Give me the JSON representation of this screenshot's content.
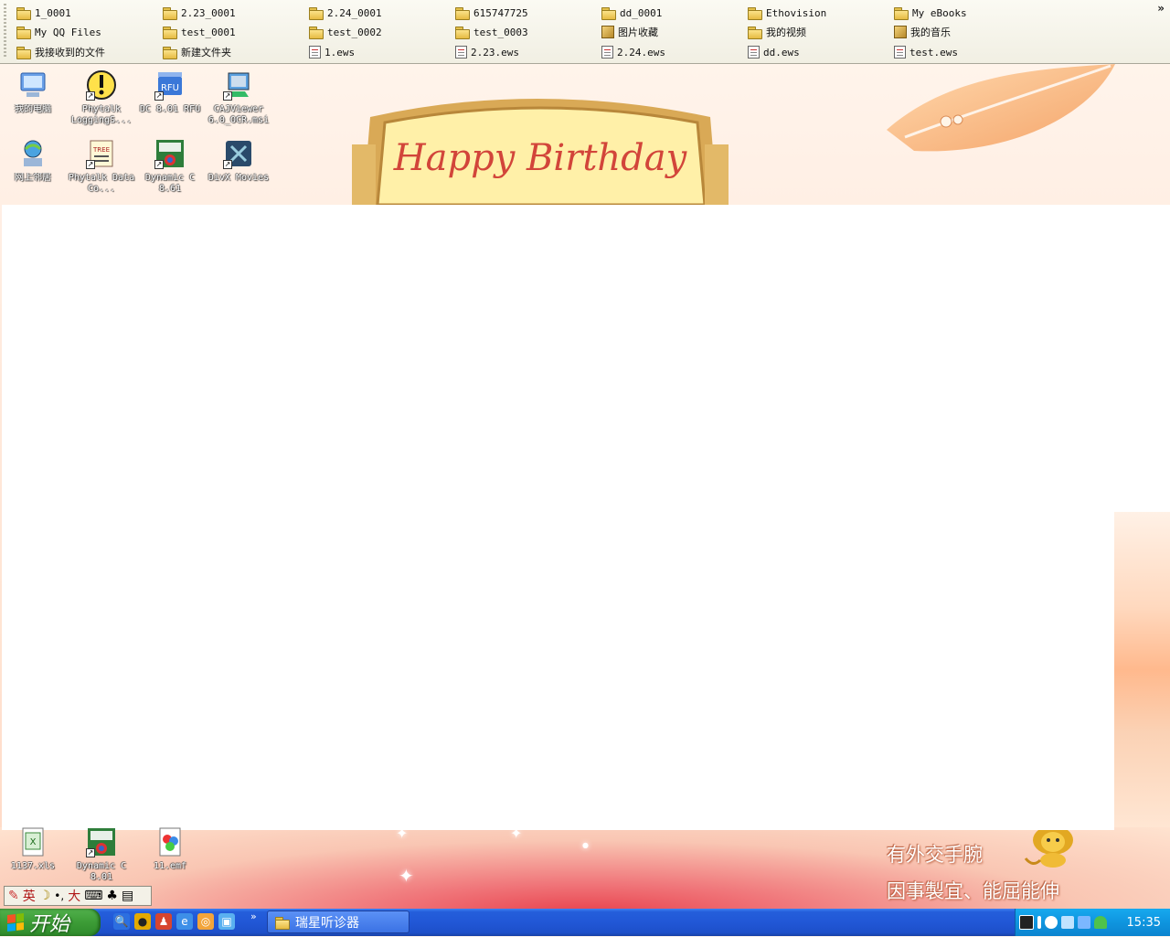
{
  "toolbar": {
    "overflow": "»",
    "items": [
      {
        "label": "1_0001",
        "icon": "folder"
      },
      {
        "label": "2.23_0001",
        "icon": "folder"
      },
      {
        "label": "2.24_0001",
        "icon": "folder"
      },
      {
        "label": "615747725",
        "icon": "folder"
      },
      {
        "label": "dd_0001",
        "icon": "folder"
      },
      {
        "label": "Ethovision",
        "icon": "folder"
      },
      {
        "label": "My eBooks",
        "icon": "folder"
      },
      {
        "label": "My QQ Files",
        "icon": "folder"
      },
      {
        "label": "test_0001",
        "icon": "folder"
      },
      {
        "label": "test_0002",
        "icon": "folder"
      },
      {
        "label": "test_0003",
        "icon": "folder"
      },
      {
        "label": "图片收藏",
        "icon": "special-folder"
      },
      {
        "label": "我的视频",
        "icon": "folder"
      },
      {
        "label": "我的音乐",
        "icon": "special-folder"
      },
      {
        "label": "我接收到的文件",
        "icon": "folder"
      },
      {
        "label": "新建文件夹",
        "icon": "folder"
      },
      {
        "label": "1.ews",
        "icon": "file"
      },
      {
        "label": "2.23.ews",
        "icon": "file"
      },
      {
        "label": "2.24.ews",
        "icon": "file"
      },
      {
        "label": "dd.ews",
        "icon": "file"
      },
      {
        "label": "test.ews",
        "icon": "file"
      }
    ]
  },
  "wallpaper": {
    "banner": "Happy Birthday",
    "motto_line1": "有外交手腕",
    "motto_line2": "因事製宜、能屈能伸"
  },
  "desktop_icons": [
    {
      "label": "我的电脑",
      "icon": "my-computer-icon"
    },
    {
      "label": "Phytalk LoggingS...",
      "icon": "phytalk-logging-icon"
    },
    {
      "label": "DC 8.01 RFU",
      "icon": "rfu-icon"
    },
    {
      "label": "CAJViewer 6.0_OCR.msi",
      "icon": "cajviewer-icon"
    },
    {
      "label": "网上邻居",
      "icon": "network-places-icon"
    },
    {
      "label": "Phytalk Data Co...",
      "icon": "phytalk-data-icon"
    },
    {
      "label": "Dynamic C 8.61",
      "icon": "dynamic-c-icon"
    },
    {
      "label": "DivX Movies",
      "icon": "divx-icon"
    },
    {
      "label": "1137.xls",
      "icon": "excel-file-icon"
    },
    {
      "label": "Dynamic C 8.01",
      "icon": "dynamic-c-icon"
    },
    {
      "label": "11.emf",
      "icon": "emf-file-icon"
    }
  ],
  "ime": {
    "mode": "英",
    "width": "大"
  },
  "taskbar": {
    "start_label": "开始",
    "quicklaunch_overflow": "»",
    "task_button": "瑞星听诊器",
    "clock": "15:35"
  },
  "colors": {
    "taskbar": "#245edb",
    "start": "#3c9c36",
    "tray": "#0f95df"
  }
}
